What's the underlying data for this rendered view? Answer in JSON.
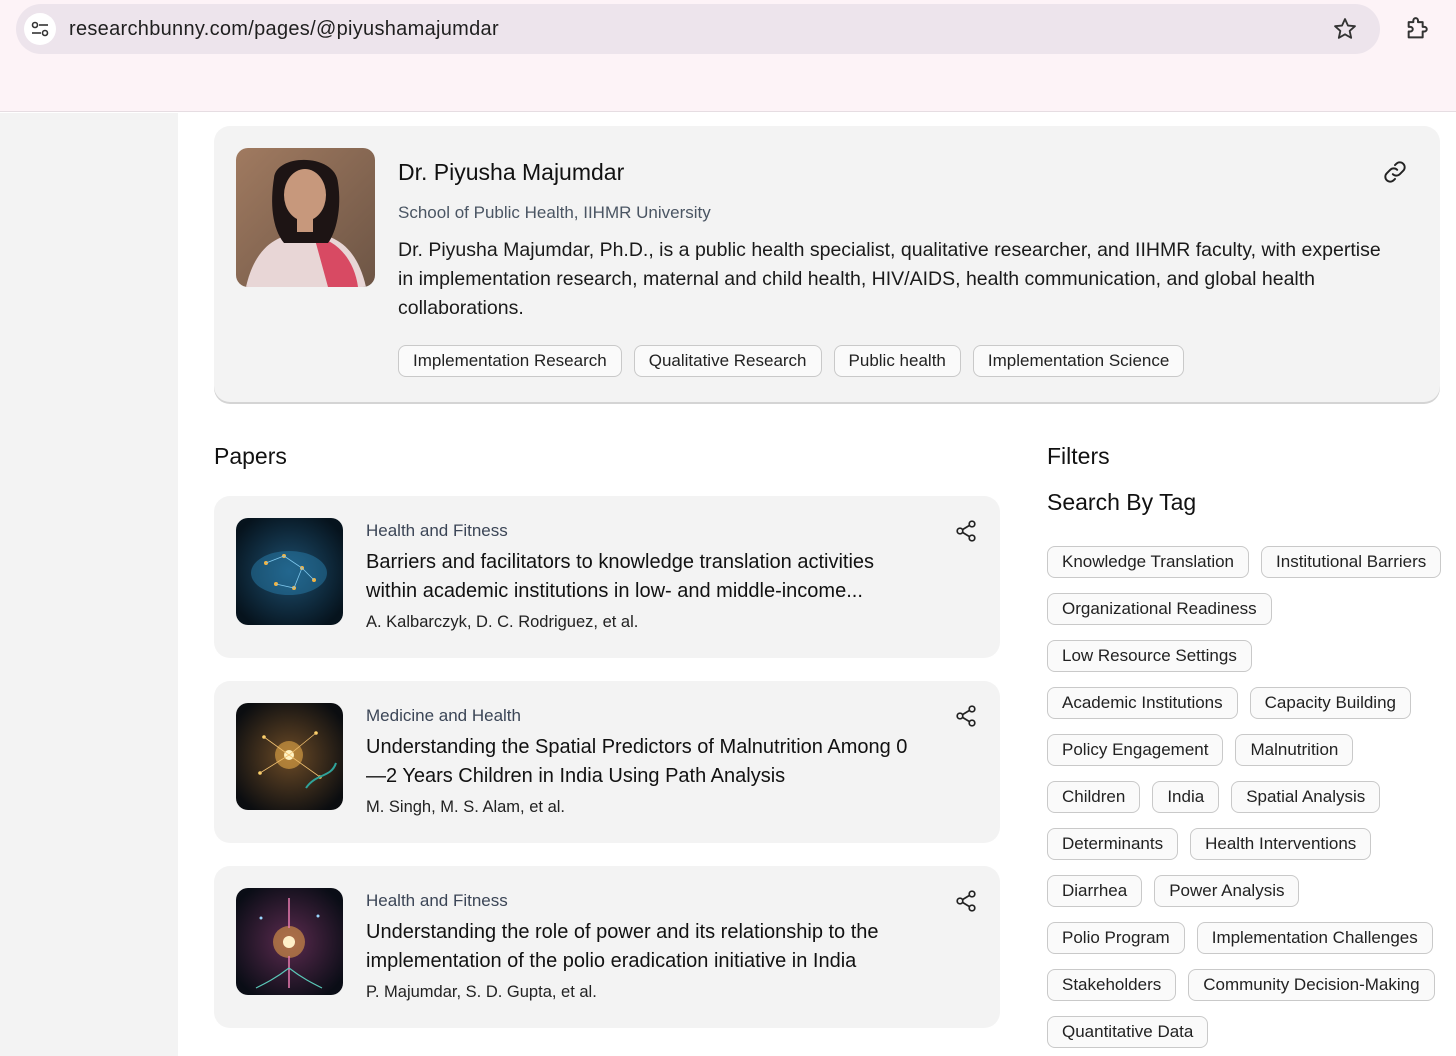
{
  "browser": {
    "url": "researchbunny.com/pages/@piyushamajumdar"
  },
  "profile": {
    "name": "Dr. Piyusha Majumdar",
    "affiliation": "School of Public Health, IIHMR University",
    "bio": "Dr. Piyusha Majumdar, Ph.D., is a public health specialist, qualitative researcher, and IIHMR faculty, with expertise in implementation research, maternal and child health, HIV/AIDS, health communication, and global health collaborations.",
    "tags": [
      "Implementation Research",
      "Qualitative Research",
      "Public health",
      "Implementation Science"
    ]
  },
  "papers_section": {
    "title": "Papers",
    "items": [
      {
        "category": "Health and Fitness",
        "title": "Barriers and facilitators to knowledge translation activities within academic institutions in low- and middle-income...",
        "authors": "A. Kalbarczyk, D. C. Rodriguez, et al."
      },
      {
        "category": "Medicine and Health",
        "title": "Understanding the Spatial Predictors of Malnutrition Among 0—2 Years Children in India Using Path Analysis",
        "authors": "M. Singh, M. S. Alam, et al."
      },
      {
        "category": "Health and Fitness",
        "title": "Understanding the role of power and its relationship to the implementation of the polio eradication initiative in India",
        "authors": "P. Majumdar, S. D. Gupta, et al."
      }
    ]
  },
  "filters": {
    "title": "Filters",
    "subtitle": "Search By Tag",
    "tag_rows": [
      [
        "Knowledge Translation",
        "Institutional Barriers"
      ],
      [
        "Organizational Readiness"
      ],
      [
        "Low Resource Settings"
      ],
      [
        "Academic Institutions",
        "Capacity Building"
      ],
      [
        "Policy Engagement",
        "Malnutrition"
      ],
      [
        "Children",
        "India",
        "Spatial Analysis"
      ],
      [
        "Determinants",
        "Health Interventions"
      ],
      [
        "Diarrhea",
        "Power Analysis"
      ],
      [
        "Polio Program",
        "Implementation Challenges"
      ],
      [
        "Stakeholders",
        "Community Decision-Making"
      ],
      [
        "Quantitative Data"
      ]
    ]
  },
  "icons": {
    "site_info": "tune-icon",
    "bookmark": "star-icon",
    "extensions": "puzzle-icon",
    "copy_link": "link-icon",
    "share": "share-icon"
  }
}
